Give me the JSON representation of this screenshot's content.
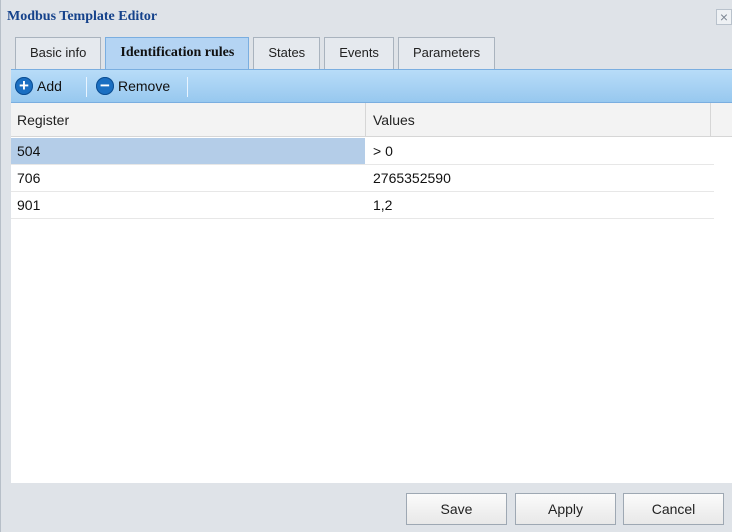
{
  "window": {
    "title": "Modbus Template Editor",
    "close_symbol": "×"
  },
  "tabs": [
    {
      "label": "Basic info",
      "active": false
    },
    {
      "label": "Identification rules",
      "active": true
    },
    {
      "label": "States",
      "active": false
    },
    {
      "label": "Events",
      "active": false
    },
    {
      "label": "Parameters",
      "active": false
    }
  ],
  "toolbar": {
    "add_label": "Add",
    "remove_label": "Remove",
    "add_icon": "plus-circle-icon",
    "remove_icon": "minus-circle-icon"
  },
  "grid": {
    "columns": [
      "Register",
      "Values"
    ],
    "rows": [
      {
        "register": "504",
        "values": "> 0",
        "selected": true
      },
      {
        "register": "706",
        "values": "2765352590",
        "selected": false
      },
      {
        "register": "901",
        "values": "1,2",
        "selected": false
      }
    ]
  },
  "footer": {
    "save_label": "Save",
    "apply_label": "Apply",
    "cancel_label": "Cancel"
  },
  "colors": {
    "accent": "#b4d4f3",
    "toolbar": "#97c8ef",
    "selection": "#b4cde8",
    "title_text": "#15428b"
  }
}
